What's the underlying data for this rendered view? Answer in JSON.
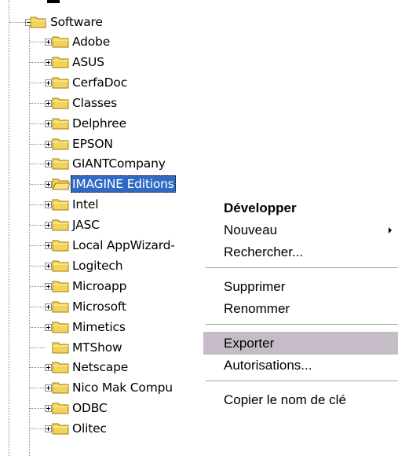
{
  "tree": {
    "root_label": "Software",
    "items": [
      {
        "label": "Adobe",
        "expander": "plus"
      },
      {
        "label": "ASUS",
        "expander": "plus"
      },
      {
        "label": "CerfaDoc",
        "expander": "plus"
      },
      {
        "label": "Classes",
        "expander": "plus"
      },
      {
        "label": "Delphree",
        "expander": "plus"
      },
      {
        "label": "EPSON",
        "expander": "plus"
      },
      {
        "label": "GIANTCompany",
        "expander": "plus"
      },
      {
        "label": "IMAGINE Editions",
        "expander": "plus",
        "selected": true
      },
      {
        "label": "Intel",
        "expander": "plus"
      },
      {
        "label": "JASC",
        "expander": "plus"
      },
      {
        "label": "Local AppWizard-",
        "expander": "plus"
      },
      {
        "label": "Logitech",
        "expander": "plus"
      },
      {
        "label": "Microapp",
        "expander": "plus"
      },
      {
        "label": "Microsoft",
        "expander": "plus"
      },
      {
        "label": "Mimetics",
        "expander": "plus"
      },
      {
        "label": "MTShow",
        "expander": "none"
      },
      {
        "label": "Netscape",
        "expander": "plus"
      },
      {
        "label": "Nico Mak Compu",
        "expander": "plus"
      },
      {
        "label": "ODBC",
        "expander": "plus"
      },
      {
        "label": "Olitec",
        "expander": "plus"
      }
    ]
  },
  "context_menu": {
    "expand": "Développer",
    "new": "Nouveau",
    "find": "Rechercher...",
    "delete": "Supprimer",
    "rename": "Renommer",
    "export": "Exporter",
    "permissions": "Autorisations...",
    "copy_key_name": "Copier le nom de clé"
  },
  "colors": {
    "selection": "#316ac5",
    "menu_highlight": "#c6bcc8",
    "folder": "#f2d35b"
  }
}
